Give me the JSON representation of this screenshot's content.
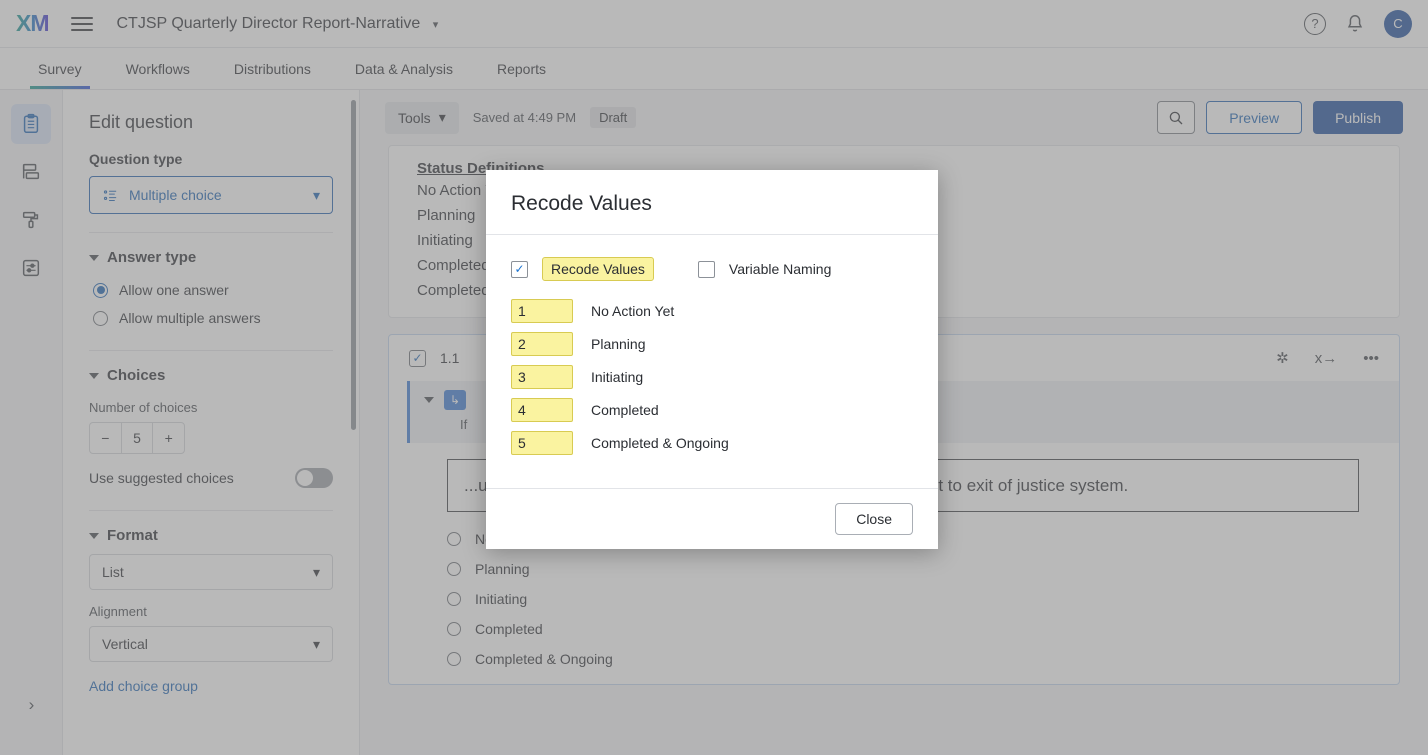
{
  "header": {
    "logo": "XM",
    "menu_icon": "hamburger-icon",
    "project_title": "CTJSP Quarterly Director Report-Narrative",
    "help_icon": "?",
    "avatar_initial": "C"
  },
  "nav_tabs": [
    {
      "label": "Survey",
      "active": true
    },
    {
      "label": "Workflows",
      "active": false
    },
    {
      "label": "Distributions",
      "active": false
    },
    {
      "label": "Data & Analysis",
      "active": false
    },
    {
      "label": "Reports",
      "active": false
    }
  ],
  "rail": [
    {
      "name": "survey-builder-icon",
      "selected": true
    },
    {
      "name": "blocks-icon",
      "selected": false
    },
    {
      "name": "look-and-feel-icon",
      "selected": false
    },
    {
      "name": "survey-options-icon",
      "selected": false
    }
  ],
  "panel": {
    "title": "Edit question",
    "question_type_label": "Question type",
    "question_type_value": "Multiple choice",
    "answer_type": {
      "section": "Answer type",
      "options": [
        {
          "label": "Allow one answer",
          "selected": true
        },
        {
          "label": "Allow multiple answers",
          "selected": false
        }
      ]
    },
    "choices": {
      "section": "Choices",
      "number_label": "Number of choices",
      "number_value": "5",
      "decrement": "−",
      "increment": "+",
      "suggested_label": "Use suggested choices",
      "suggested_on": false
    },
    "format": {
      "section": "Format",
      "format_value": "List",
      "alignment_label": "Alignment",
      "alignment_value": "Vertical"
    },
    "add_choice_group": "Add choice group"
  },
  "toolbar": {
    "tools_label": "Tools",
    "saved_text": "Saved at 4:49 PM",
    "draft_badge": "Draft",
    "search_icon": "search-icon",
    "preview_label": "Preview",
    "publish_label": "Publish"
  },
  "canvas": {
    "definitions_heading": "Status Definitions",
    "definitions_lines": [
      "No Action Yet",
      "Planning",
      "Initiating",
      "Completed",
      "Completed & Ongoing — Continuous"
    ],
    "question": {
      "number": "1.1",
      "logic_if": "If",
      "text": "...update sentencing structure by performing a ...n time of arrest to exit of justice system.",
      "icons": {
        "star": "✲",
        "piped_text": "x→",
        "more": "•••"
      },
      "choices": [
        "No Action Yet",
        "Planning",
        "Initiating",
        "Completed",
        "Completed & Ongoing"
      ]
    }
  },
  "modal": {
    "title": "Recode Values",
    "recode_checkbox": {
      "label": "Recode Values",
      "checked": true
    },
    "variable_naming_checkbox": {
      "label": "Variable Naming",
      "checked": false
    },
    "rows": [
      {
        "value": "1",
        "label": "No Action Yet"
      },
      {
        "value": "2",
        "label": "Planning"
      },
      {
        "value": "3",
        "label": "Initiating"
      },
      {
        "value": "4",
        "label": "Completed"
      },
      {
        "value": "5",
        "label": "Completed & Ongoing"
      }
    ],
    "close_label": "Close"
  },
  "colors": {
    "accent_blue": "#1d4f9e",
    "link_blue": "#1a62b3",
    "yellow_field": "#faf3a0",
    "yellow_border": "#d8cb52"
  }
}
